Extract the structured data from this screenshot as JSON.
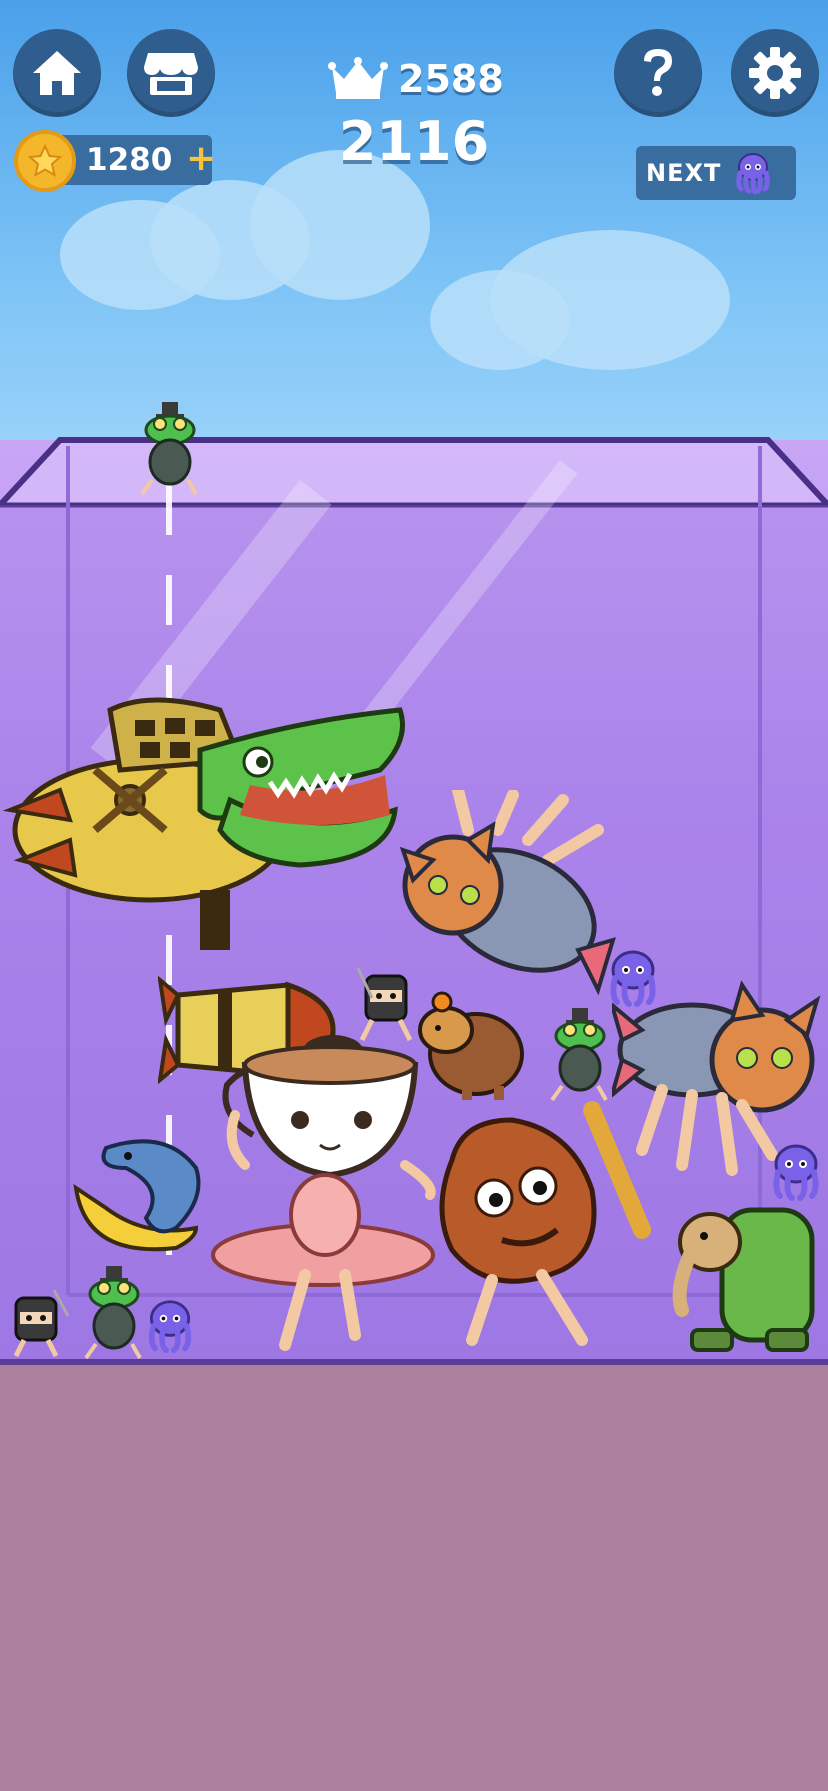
{
  "hud": {
    "coins": "1280",
    "coin_plus": "+",
    "best_score": "2588",
    "score": "2116",
    "next_label": "NEXT"
  },
  "icons": {
    "home": "home-icon",
    "shop": "shop-icon",
    "help": "question-icon",
    "settings": "gear-icon",
    "crown": "crown-icon",
    "coin": "star-coin-icon",
    "next_piece": "octopus-icon"
  },
  "colors": {
    "button_bg": "#2f5e8e",
    "jar_purple": "#b58ef0",
    "ground": "#ad809d",
    "coin": "#f4b62a"
  },
  "pieces": [
    "frog-turtle",
    "crocodile-plane",
    "rocket",
    "cat-fish",
    "cat-fish",
    "octopus",
    "octopus",
    "octopus",
    "ninja",
    "ninja",
    "capybara",
    "frog-turtle",
    "frog-turtle",
    "cappuccino-ballerina",
    "tree-trunk-bat",
    "dolphin-banana",
    "cactus-elephant"
  ]
}
